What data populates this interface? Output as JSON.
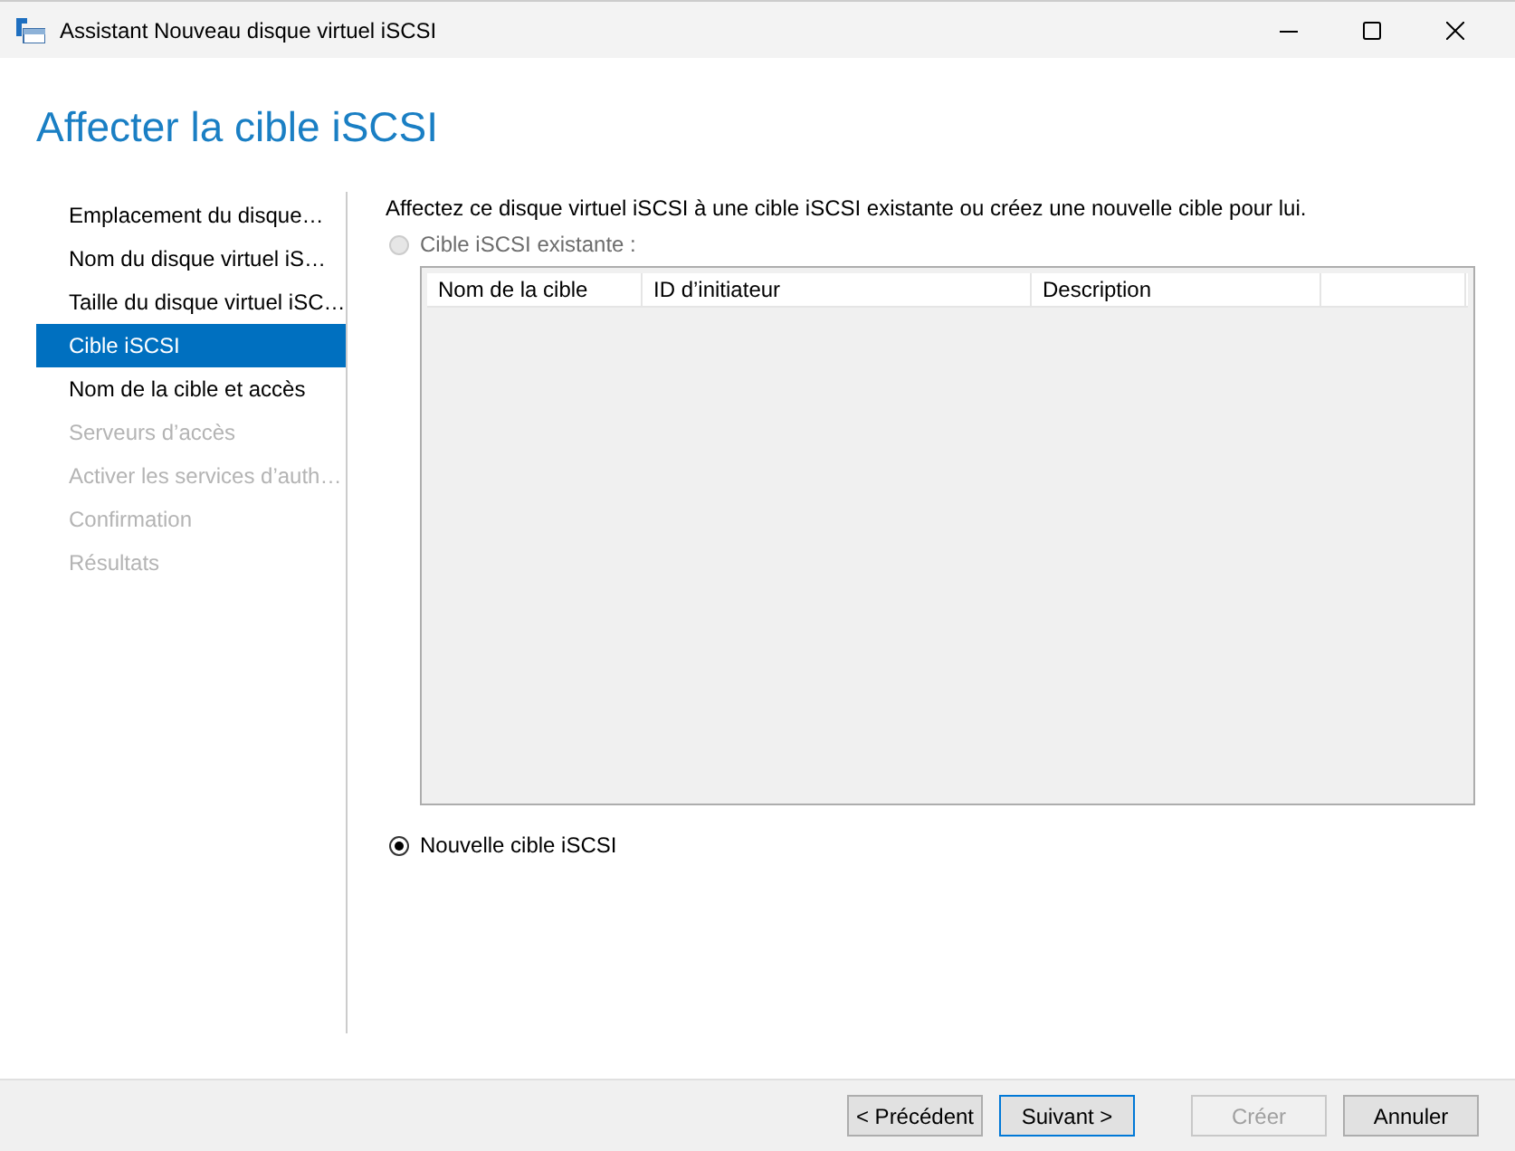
{
  "window": {
    "title": "Assistant Nouveau disque virtuel iSCSI"
  },
  "page_title": "Affecter la cible iSCSI",
  "steps": [
    {
      "label": "Emplacement du disque…",
      "selected": false,
      "disabled": false
    },
    {
      "label": "Nom du disque virtuel iS…",
      "selected": false,
      "disabled": false
    },
    {
      "label": "Taille du disque virtuel iSC…",
      "selected": false,
      "disabled": false
    },
    {
      "label": "Cible iSCSI",
      "selected": true,
      "disabled": false
    },
    {
      "label": "Nom de la cible et accès",
      "selected": false,
      "disabled": false
    },
    {
      "label": "Serveurs d’accès",
      "selected": false,
      "disabled": true
    },
    {
      "label": "Activer les services d’auth…",
      "selected": false,
      "disabled": true
    },
    {
      "label": "Confirmation",
      "selected": false,
      "disabled": true
    },
    {
      "label": "Résultats",
      "selected": false,
      "disabled": true
    }
  ],
  "intro": "Affectez ce disque virtuel iSCSI à une cible iSCSI existante ou créez une nouvelle cible pour lui.",
  "options": [
    {
      "label": "Cible iSCSI existante :",
      "selected": false,
      "disabled": true
    },
    {
      "label": "Nouvelle cible iSCSI",
      "selected": true,
      "disabled": false
    }
  ],
  "table": {
    "columns": [
      "Nom de la cible",
      "ID d’initiateur",
      "Description"
    ]
  },
  "buttons": [
    {
      "label": "< Précédent",
      "disabled": false,
      "default": false
    },
    {
      "label": "Suivant >",
      "disabled": false,
      "default": true
    },
    {
      "label": "Créer",
      "disabled": true,
      "default": false
    },
    {
      "label": "Annuler",
      "disabled": false,
      "default": false
    }
  ]
}
